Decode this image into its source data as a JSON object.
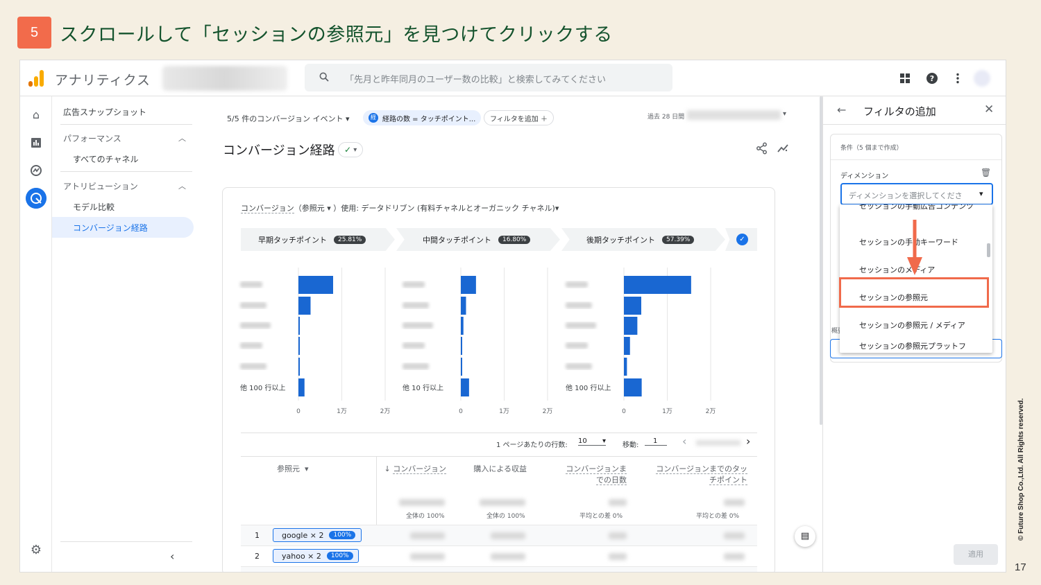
{
  "slide": {
    "step_number": "5",
    "title": "スクロールして「セッションの参照元」を見つけてクリックする",
    "copyright": "© Future Shop Co.,Ltd. All Rights reserved.",
    "page_number": "17"
  },
  "colors": {
    "accent_orange": "#f26b4b",
    "title_green": "#14532d",
    "ga_blue": "#1a73e8",
    "bar_blue": "#1967d2"
  },
  "topbar": {
    "app_name": "アナリティクス",
    "search_placeholder": "「先月と昨年同月のユーザー数の比較」と検索してみてください",
    "icons": [
      "apps-grid-icon",
      "help-icon",
      "more-vert-icon"
    ]
  },
  "nav": {
    "snapshot": "広告スナップショット",
    "performance": "パフォーマンス",
    "all_channels": "すべてのチャネル",
    "attribution": "アトリビューション",
    "model_compare": "モデル比較",
    "conversion_paths": "コンバージョン経路"
  },
  "main": {
    "conv_events": "5/5 件のコンバージョン イベント",
    "filter_chip": "経路の数 = タッチポイント...",
    "filter_chip_badge": "経",
    "add_filter": "フィルタを追加",
    "date_range": "過去 28 日間",
    "page_title": "コンバージョン経路",
    "model_line_a": "コンバージョン",
    "model_line_b": "（参照元 ▾ ）使用: データドリブン (有料チャネルとオーガニック チャネル)▾",
    "touchpoints": [
      {
        "label": "早期タッチポイント",
        "pct": "25.81%"
      },
      {
        "label": "中間タッチポイント",
        "pct": "16.80%"
      },
      {
        "label": "後期タッチポイント",
        "pct": "57.39%"
      }
    ],
    "others": [
      "他 100 行以上",
      "他 10 行以上",
      "他 100 行以上"
    ],
    "axis_ticks": [
      "0",
      "1万",
      "2万"
    ],
    "rows_per_page_label": "1 ページあたりの行数:",
    "rows_per_page_value": "10",
    "goto_label": "移動:",
    "goto_value": "1",
    "table_headers": {
      "source": "参照元",
      "conversions": "コンバージョン",
      "revenue": "購入による収益",
      "days": "コンバージョンまでの日数",
      "touchpoints": "コンバージョンまでのタッチポイント"
    },
    "totals": {
      "conversions": "全体の 100%",
      "revenue": "全体の 100%",
      "days": "平均との差 0%",
      "touchpoints": "平均との差 0%"
    },
    "rows": [
      {
        "num": "1",
        "label": "google × 2",
        "pct": "100%"
      },
      {
        "num": "2",
        "label": "yahoo × 2",
        "pct": "100%"
      }
    ]
  },
  "chart_data": [
    {
      "type": "bar",
      "title": "早期タッチポイント",
      "values": [
        8000,
        2800,
        300,
        200,
        200,
        1400
      ],
      "xlim": [
        0,
        20000
      ],
      "ticks": [
        "0",
        "1万",
        "2万"
      ]
    },
    {
      "type": "bar",
      "title": "中間タッチポイント",
      "values": [
        3500,
        1200,
        600,
        300,
        300,
        1900
      ],
      "xlim": [
        0,
        20000
      ],
      "ticks": [
        "0",
        "1万",
        "2万"
      ]
    },
    {
      "type": "bar",
      "title": "後期タッチポイント",
      "values": [
        15500,
        4000,
        3100,
        1400,
        700,
        4100
      ],
      "xlim": [
        0,
        20000
      ],
      "ticks": [
        "0",
        "1万",
        "2万"
      ]
    }
  ],
  "panel": {
    "title": "フィルタの追加",
    "conditions": "条件（5 個まで作成）",
    "dimension_label": "ディメンション",
    "dimension_placeholder": "ディメンションを選択してくださ",
    "options": [
      "セッションの手動広告コンテンツ",
      "セッションの手動キーワード",
      "セッションのメディア",
      "セッションの参照元",
      "セッションの参照元 / メディア",
      "セッションの参照元プラットフ"
    ],
    "overview_label": "概要",
    "apply": "適用"
  }
}
